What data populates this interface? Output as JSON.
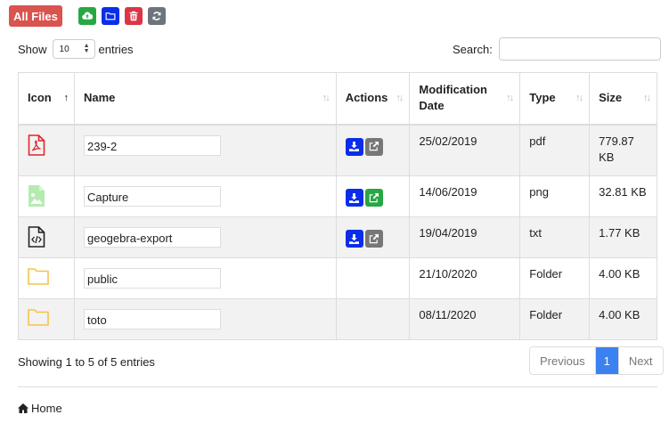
{
  "toolbar": {
    "all_files_label": "All Files",
    "buttons": [
      {
        "icon": "cloud-upload-icon",
        "color": "#28a745"
      },
      {
        "icon": "new-folder-icon",
        "color": "#0a2dea"
      },
      {
        "icon": "trash-icon",
        "color": "#dc3545"
      },
      {
        "icon": "refresh-icon",
        "color": "#6c757d"
      }
    ]
  },
  "length": {
    "show_label": "Show",
    "value": "10",
    "entries_label": "entries"
  },
  "search": {
    "label": "Search:",
    "value": ""
  },
  "table": {
    "columns": [
      {
        "label": "Icon",
        "sort": "asc"
      },
      {
        "label": "Name",
        "sort": "none"
      },
      {
        "label": "Actions",
        "sort": "none"
      },
      {
        "label": "Modification Date",
        "sort": "none"
      },
      {
        "label": "Type",
        "sort": "none"
      },
      {
        "label": "Size",
        "sort": "none"
      }
    ],
    "rows": [
      {
        "icon": "pdf-file-icon",
        "name": "239-2",
        "actions": [
          "download",
          "share-gray"
        ],
        "date": "25/02/2019",
        "type": "pdf",
        "size": "779.87 KB"
      },
      {
        "icon": "image-file-icon",
        "name": "Capture",
        "actions": [
          "download",
          "share-green"
        ],
        "date": "14/06/2019",
        "type": "png",
        "size": "32.81 KB"
      },
      {
        "icon": "code-file-icon",
        "name": "geogebra-export",
        "actions": [
          "download",
          "share-gray"
        ],
        "date": "19/04/2019",
        "type": "txt",
        "size": "1.77 KB"
      },
      {
        "icon": "folder-icon",
        "name": "public",
        "actions": [],
        "date": "21/10/2020",
        "type": "Folder",
        "size": "4.00 KB"
      },
      {
        "icon": "folder-icon",
        "name": "toto",
        "actions": [],
        "date": "08/11/2020",
        "type": "Folder",
        "size": "4.00 KB"
      }
    ]
  },
  "info": "Showing 1 to 5 of 5 entries",
  "pagination": {
    "previous": "Previous",
    "current": "1",
    "next": "Next"
  },
  "breadcrumb": {
    "home": "Home"
  }
}
